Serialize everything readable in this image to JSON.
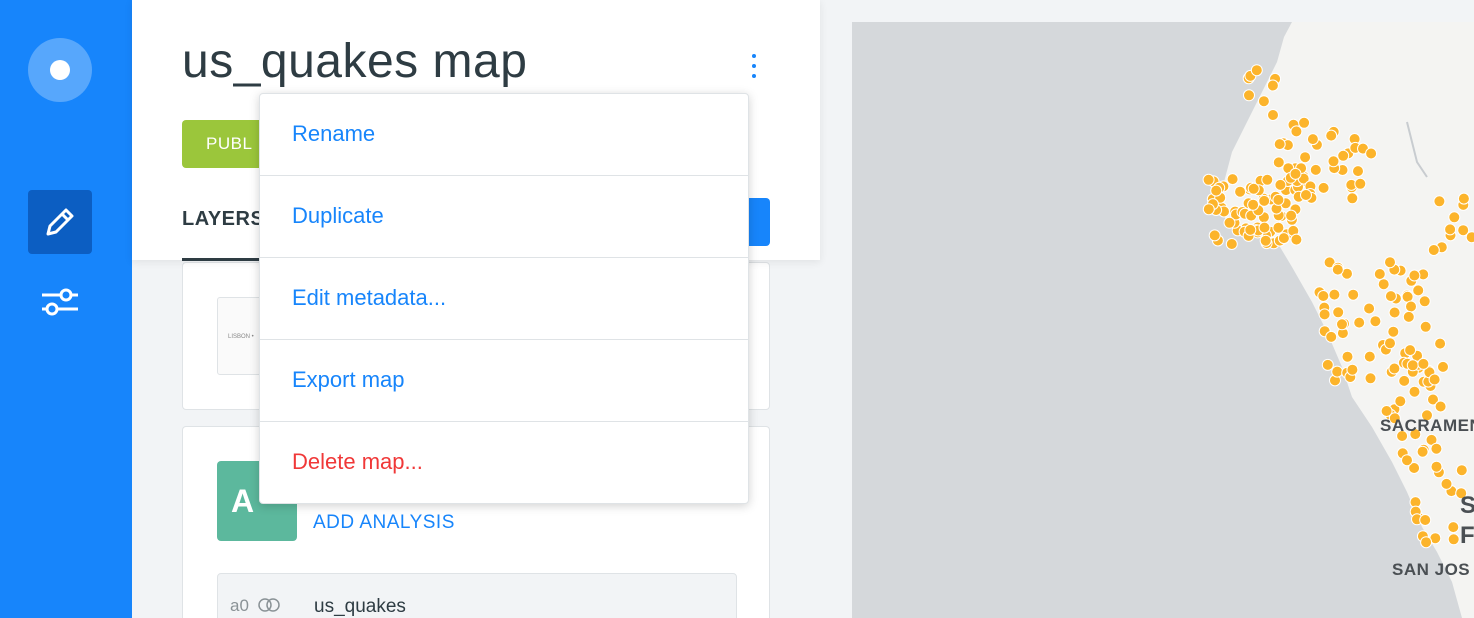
{
  "sidebar": {
    "logo_icon": "carto-logo-icon",
    "items": [
      {
        "icon": "pencil-icon",
        "active": true
      },
      {
        "icon": "sliders-icon",
        "active": false
      }
    ]
  },
  "header": {
    "map_title": "us_quakes map",
    "privacy_label": "PUBL",
    "tab_layers": "LAYERS"
  },
  "layers": {
    "basemap_thumb_label": "LISBON •",
    "layer_letter": "A",
    "add_analysis_label": "ADD ANALYSIS",
    "source_id": "a0",
    "source_name": "us_quakes"
  },
  "menu": {
    "items": [
      {
        "label": "Rename",
        "type": "normal"
      },
      {
        "label": "Duplicate",
        "type": "normal"
      },
      {
        "label": "Edit metadata...",
        "type": "normal"
      },
      {
        "label": "Export map",
        "type": "normal"
      },
      {
        "label": "Delete map...",
        "type": "danger"
      }
    ]
  },
  "map": {
    "cities": [
      "SACRAMENTO",
      "S",
      "F",
      "SAN JOS"
    ],
    "colors": {
      "point": "#fcb42b",
      "point_border": "#ffffff",
      "land": "#f4f4f2",
      "water": "#d5d8db"
    }
  },
  "colors": {
    "accent": "#1785fb",
    "danger": "#f03838",
    "public": "#9bc63b",
    "text": "#2e3c43"
  }
}
